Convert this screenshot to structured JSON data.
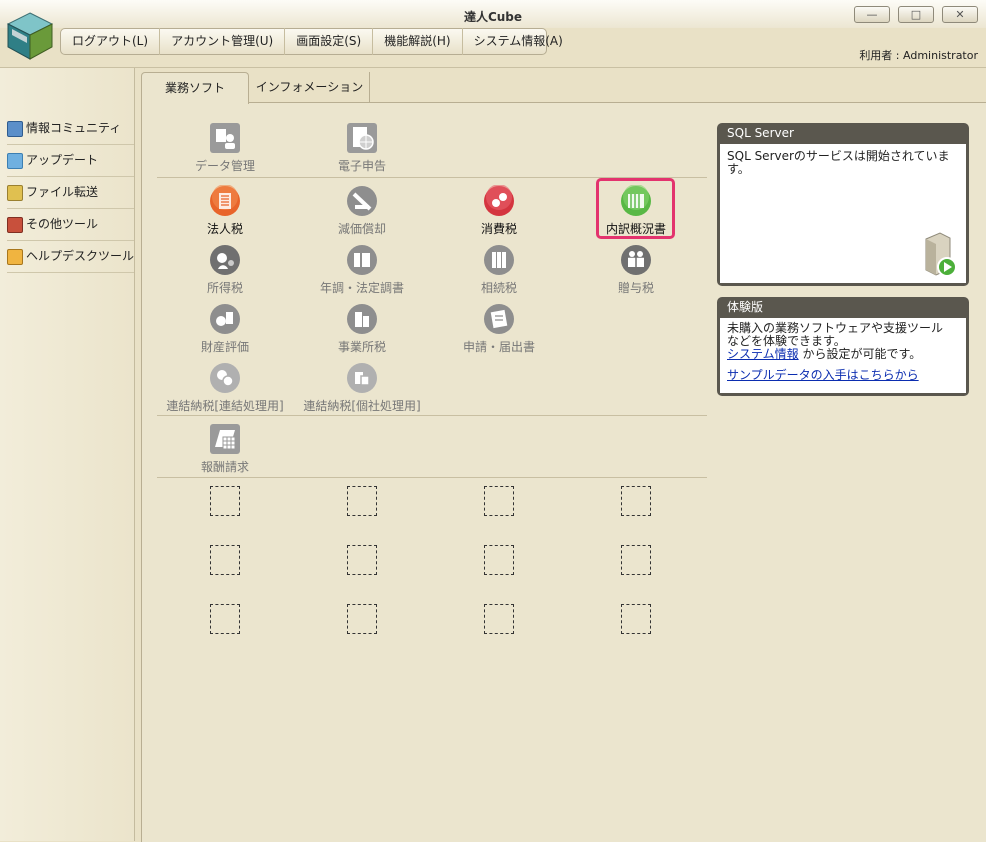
{
  "window": {
    "title": "達人Cube"
  },
  "menubar": {
    "items": [
      {
        "label": "ログアウト(L)"
      },
      {
        "label": "アカウント管理(U)"
      },
      {
        "label": "画面設定(S)"
      },
      {
        "label": "機能解説(H)"
      },
      {
        "label": "システム情報(A)"
      }
    ]
  },
  "user": {
    "label": "利用者 : Administrator"
  },
  "sidebar": {
    "items": [
      {
        "label": "情報コミュニティ",
        "icon": "community-icon"
      },
      {
        "label": "アップデート",
        "icon": "update-icon"
      },
      {
        "label": "ファイル転送",
        "icon": "file-transfer-icon"
      },
      {
        "label": "その他ツール",
        "icon": "tools-icon"
      },
      {
        "label": "ヘルプデスクツール",
        "icon": "helpdesk-icon"
      }
    ]
  },
  "tabs": [
    {
      "label": "業務ソフト",
      "active": true
    },
    {
      "label": "インフォメーション",
      "active": false
    }
  ],
  "apps": {
    "row0": [
      {
        "label": "データ管理",
        "enabled": false
      },
      {
        "label": "電子申告",
        "enabled": false
      }
    ],
    "row1": [
      {
        "label": "法人税",
        "enabled": true,
        "color": "#e8642a"
      },
      {
        "label": "減価償却",
        "enabled": false
      },
      {
        "label": "消費税",
        "enabled": true,
        "color": "#d4353f"
      },
      {
        "label": "内訳概況書",
        "enabled": true,
        "color": "#58b845"
      }
    ],
    "row2": [
      {
        "label": "所得税",
        "enabled": false
      },
      {
        "label": "年調・法定調書",
        "enabled": false
      },
      {
        "label": "相続税",
        "enabled": false
      },
      {
        "label": "贈与税",
        "enabled": false
      }
    ],
    "row3": [
      {
        "label": "財産評価",
        "enabled": false
      },
      {
        "label": "事業所税",
        "enabled": false
      },
      {
        "label": "申請・届出書",
        "enabled": false
      }
    ],
    "row4": [
      {
        "label": "連結納税[連結処理用]",
        "enabled": false
      },
      {
        "label": "連結納税[個社処理用]",
        "enabled": false
      }
    ],
    "row5": [
      {
        "label": "報酬請求",
        "enabled": false
      }
    ]
  },
  "panels": {
    "sql": {
      "title": "SQL Server",
      "message": "SQL Serverのサービスは開始されています。"
    },
    "trial": {
      "title": "体験版",
      "line1": "未購入の業務ソフトウェアや支援ツール",
      "line2": "などを体験できます。",
      "link1": "システム情報",
      "line3": " から設定が可能です。",
      "link2": "サンプルデータの入手はこちらから"
    }
  },
  "colors": {
    "highlight": "#e3336e",
    "link": "#0b2db0"
  }
}
